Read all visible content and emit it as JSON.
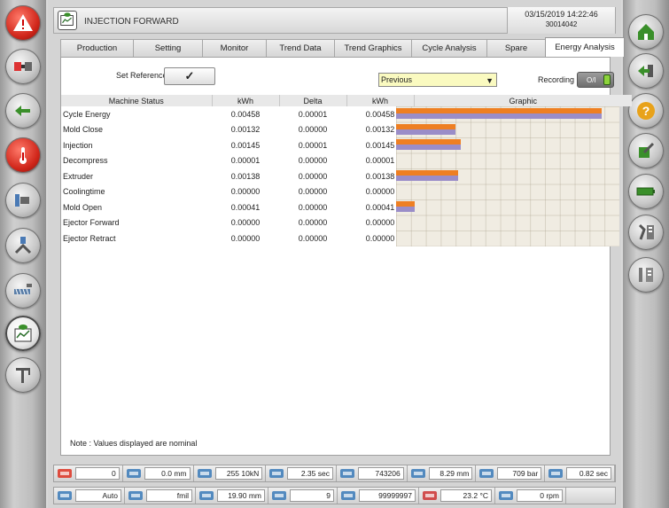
{
  "window": {
    "title": "INJECTION FORWARD",
    "datetime": "03/15/2019 14:22:46",
    "machine_id": "30014042"
  },
  "tabs": [
    {
      "label": "Production",
      "active": false
    },
    {
      "label": "Setting",
      "active": false
    },
    {
      "label": "Monitor",
      "active": false
    },
    {
      "label": "Trend Data",
      "active": false
    },
    {
      "label": "Trend Graphics",
      "active": false
    },
    {
      "label": "Cycle Analysis",
      "active": false
    },
    {
      "label": "Spare",
      "active": false
    },
    {
      "label": "Energy Analysis",
      "active": true
    }
  ],
  "controls": {
    "set_reference_label": "Set Reference",
    "set_reference_check": "✓",
    "compare_select_value": "Previous",
    "recording_label": "Recording",
    "recording_toggle": "O/I"
  },
  "table": {
    "headers": [
      "Machine Status",
      "kWh",
      "Delta",
      "kWh",
      "Graphic"
    ],
    "rows": [
      {
        "name": "Cycle Energy",
        "kwh": "0.00458",
        "delta": "0.00001",
        "kwh2": "0.00458",
        "ref_fraction": 0.92,
        "cur_fraction": 0.92
      },
      {
        "name": "Mold Close",
        "kwh": "0.00132",
        "delta": "0.00000",
        "kwh2": "0.00132",
        "ref_fraction": 0.265,
        "cur_fraction": 0.265
      },
      {
        "name": "Injection",
        "kwh": "0.00145",
        "delta": "0.00001",
        "kwh2": "0.00145",
        "ref_fraction": 0.29,
        "cur_fraction": 0.29
      },
      {
        "name": "Decompress",
        "kwh": "0.00001",
        "delta": "0.00000",
        "kwh2": "0.00001",
        "ref_fraction": 0,
        "cur_fraction": 0
      },
      {
        "name": "Extruder",
        "kwh": "0.00138",
        "delta": "0.00000",
        "kwh2": "0.00138",
        "ref_fraction": 0.277,
        "cur_fraction": 0.277
      },
      {
        "name": "Coolingtime",
        "kwh": "0.00000",
        "delta": "0.00000",
        "kwh2": "0.00000",
        "ref_fraction": 0,
        "cur_fraction": 0
      },
      {
        "name": "Mold Open",
        "kwh": "0.00041",
        "delta": "0.00000",
        "kwh2": "0.00041",
        "ref_fraction": 0.082,
        "cur_fraction": 0.082
      },
      {
        "name": "Ejector Forward",
        "kwh": "0.00000",
        "delta": "0.00000",
        "kwh2": "0.00000",
        "ref_fraction": 0,
        "cur_fraction": 0
      },
      {
        "name": "Ejector Retract",
        "kwh": "0.00000",
        "delta": "0.00000",
        "kwh2": "0.00000",
        "ref_fraction": 0,
        "cur_fraction": 0
      }
    ],
    "bar_colors": {
      "reference": "#ee7f22",
      "current": "#9a8dc8"
    }
  },
  "note": "Note : Values displayed are nominal",
  "status1": [
    {
      "icon": "alarm-count-icon",
      "value": "0"
    },
    {
      "icon": "mold-position-icon",
      "value": "0.0 mm"
    },
    {
      "icon": "clamp-force-icon",
      "value": "255 10kN"
    },
    {
      "icon": "cycle-time-icon",
      "value": "2.35 sec"
    },
    {
      "icon": "shot-counter-icon",
      "value": "743206"
    },
    {
      "icon": "screw-position-icon",
      "value": "8.29 mm"
    },
    {
      "icon": "injection-pressure-icon",
      "value": "709 bar"
    },
    {
      "icon": "injection-time-icon",
      "value": "0.82 sec"
    }
  ],
  "status2": [
    {
      "icon": "mode-icon",
      "value": "Auto"
    },
    {
      "icon": "user-icon",
      "value": "fmil"
    },
    {
      "icon": "cushion-icon",
      "value": "19.90 mm"
    },
    {
      "icon": "cavities-icon",
      "value": "9"
    },
    {
      "icon": "target-count-icon",
      "value": "99999997"
    },
    {
      "icon": "temperature-icon",
      "value": "23.2 °C"
    },
    {
      "icon": "screw-speed-icon",
      "value": "0 rpm"
    }
  ],
  "left_nav": [
    "alarm-icon",
    "mold-icon",
    "ejector-icon",
    "temperature-icon",
    "injection-icon",
    "robot-icon",
    "screw-icon",
    "energy-monitor-icon",
    "crane-icon"
  ],
  "right_nav": [
    "home-icon",
    "back-icon",
    "help-icon",
    "edit-icon",
    "battery-icon",
    "tools-icon",
    "tool-settings-icon"
  ]
}
